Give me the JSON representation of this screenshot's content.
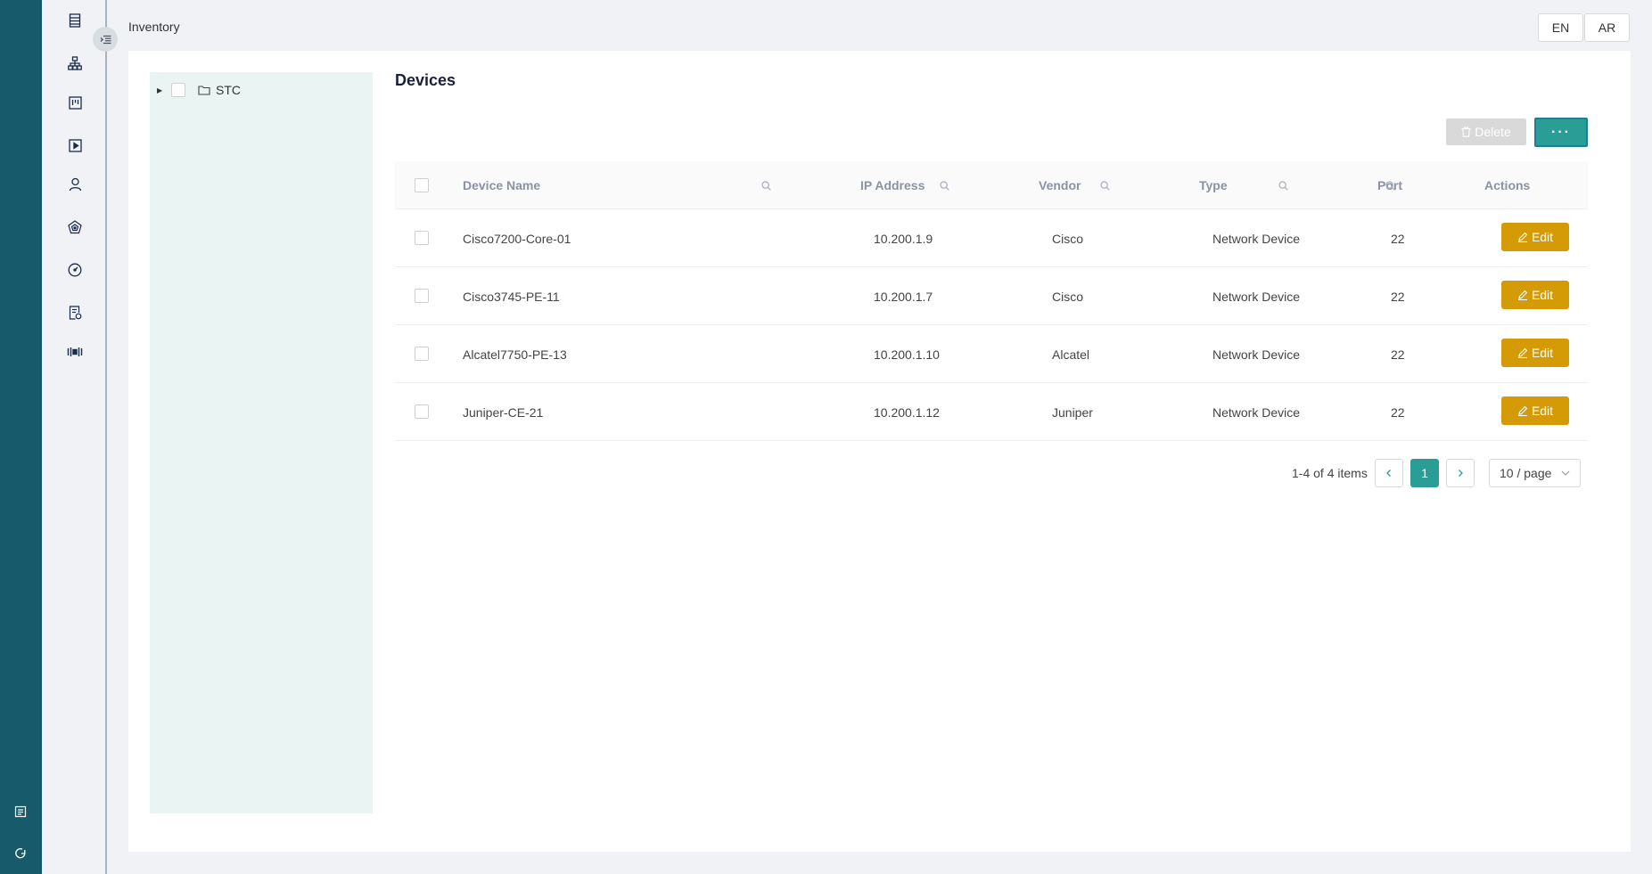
{
  "header": {
    "breadcrumb": "Inventory",
    "lang_en": "EN",
    "lang_ar": "AR"
  },
  "nav": {
    "icons": [
      "list-icon",
      "topology-icon",
      "board-icon",
      "play-icon",
      "user-icon",
      "network-icon",
      "dashboard-icon",
      "report-icon",
      "settings-icon"
    ],
    "bottom_icons": [
      "log-icon",
      "logout-icon"
    ]
  },
  "tree": {
    "root_label": "STC"
  },
  "devices": {
    "title": "Devices",
    "delete_label": "Delete",
    "more_label": "···",
    "columns": {
      "name": "Device Name",
      "ip": "IP Address",
      "vendor": "Vendor",
      "type": "Type",
      "port": "Port",
      "actions": "Actions"
    },
    "edit_label": "Edit",
    "rows": [
      {
        "name": "Cisco7200-Core-01",
        "ip": "10.200.1.9",
        "vendor": "Cisco",
        "type": "Network Device",
        "port": "22"
      },
      {
        "name": "Cisco3745-PE-11",
        "ip": "10.200.1.7",
        "vendor": "Cisco",
        "type": "Network Device",
        "port": "22"
      },
      {
        "name": "Alcatel7750-PE-13",
        "ip": "10.200.1.10",
        "vendor": "Alcatel",
        "type": "Network Device",
        "port": "22"
      },
      {
        "name": "Juniper-CE-21",
        "ip": "10.200.1.12",
        "vendor": "Juniper",
        "type": "Network Device",
        "port": "22"
      }
    ]
  },
  "pagination": {
    "total": "1-4 of 4 items",
    "current_page": "1",
    "page_size": "10 / page"
  },
  "colors": {
    "sidebar": "#165a6b",
    "primary": "#2a9d96",
    "edit": "#d49b06",
    "tree_bg": "#eaf4f2"
  }
}
